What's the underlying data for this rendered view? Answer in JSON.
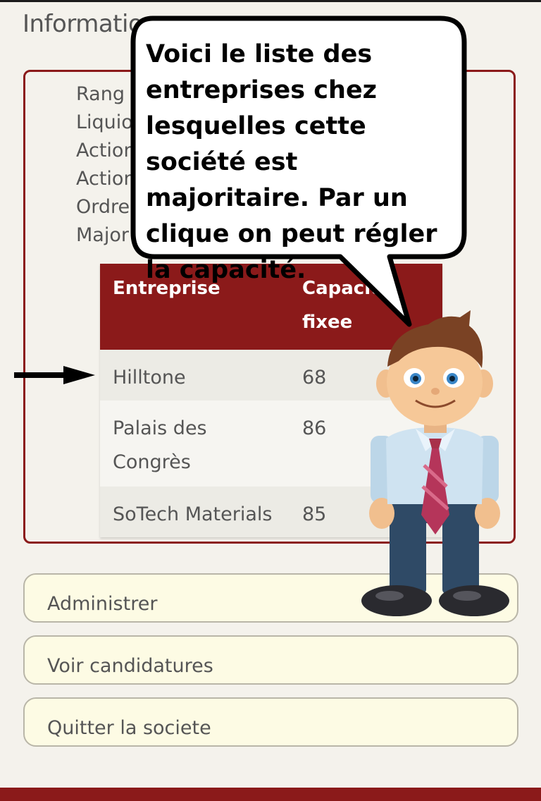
{
  "header": {
    "title": "Informatio"
  },
  "info": {
    "lines": [
      "Rang",
      "Liquio",
      "Action",
      "Action",
      "Ordre",
      "Major"
    ]
  },
  "table": {
    "headers": [
      "Entreprise",
      "Capacité fixee"
    ],
    "rows": [
      {
        "name": "Hilltone",
        "capacity": "68"
      },
      {
        "name": "Palais des Congrès",
        "capacity": "86"
      },
      {
        "name": "SoTech Materials",
        "capacity": "85"
      }
    ]
  },
  "buttons": {
    "administrer": "Administrer",
    "voir_candidatures": "Voir candidatures",
    "quitter": "Quitter la societe"
  },
  "tutorial": {
    "message": "Voici le liste des entreprises chez lesquelles cette société est majoritaire. Par un clique on peut régler la capacité."
  },
  "colors": {
    "brand": "#8b1a1a",
    "background": "#f4f2ec",
    "button_bg": "#fdfbe4"
  },
  "icons": {
    "pointer": "arrow-right-icon",
    "mascot": "businessman-mascot"
  }
}
